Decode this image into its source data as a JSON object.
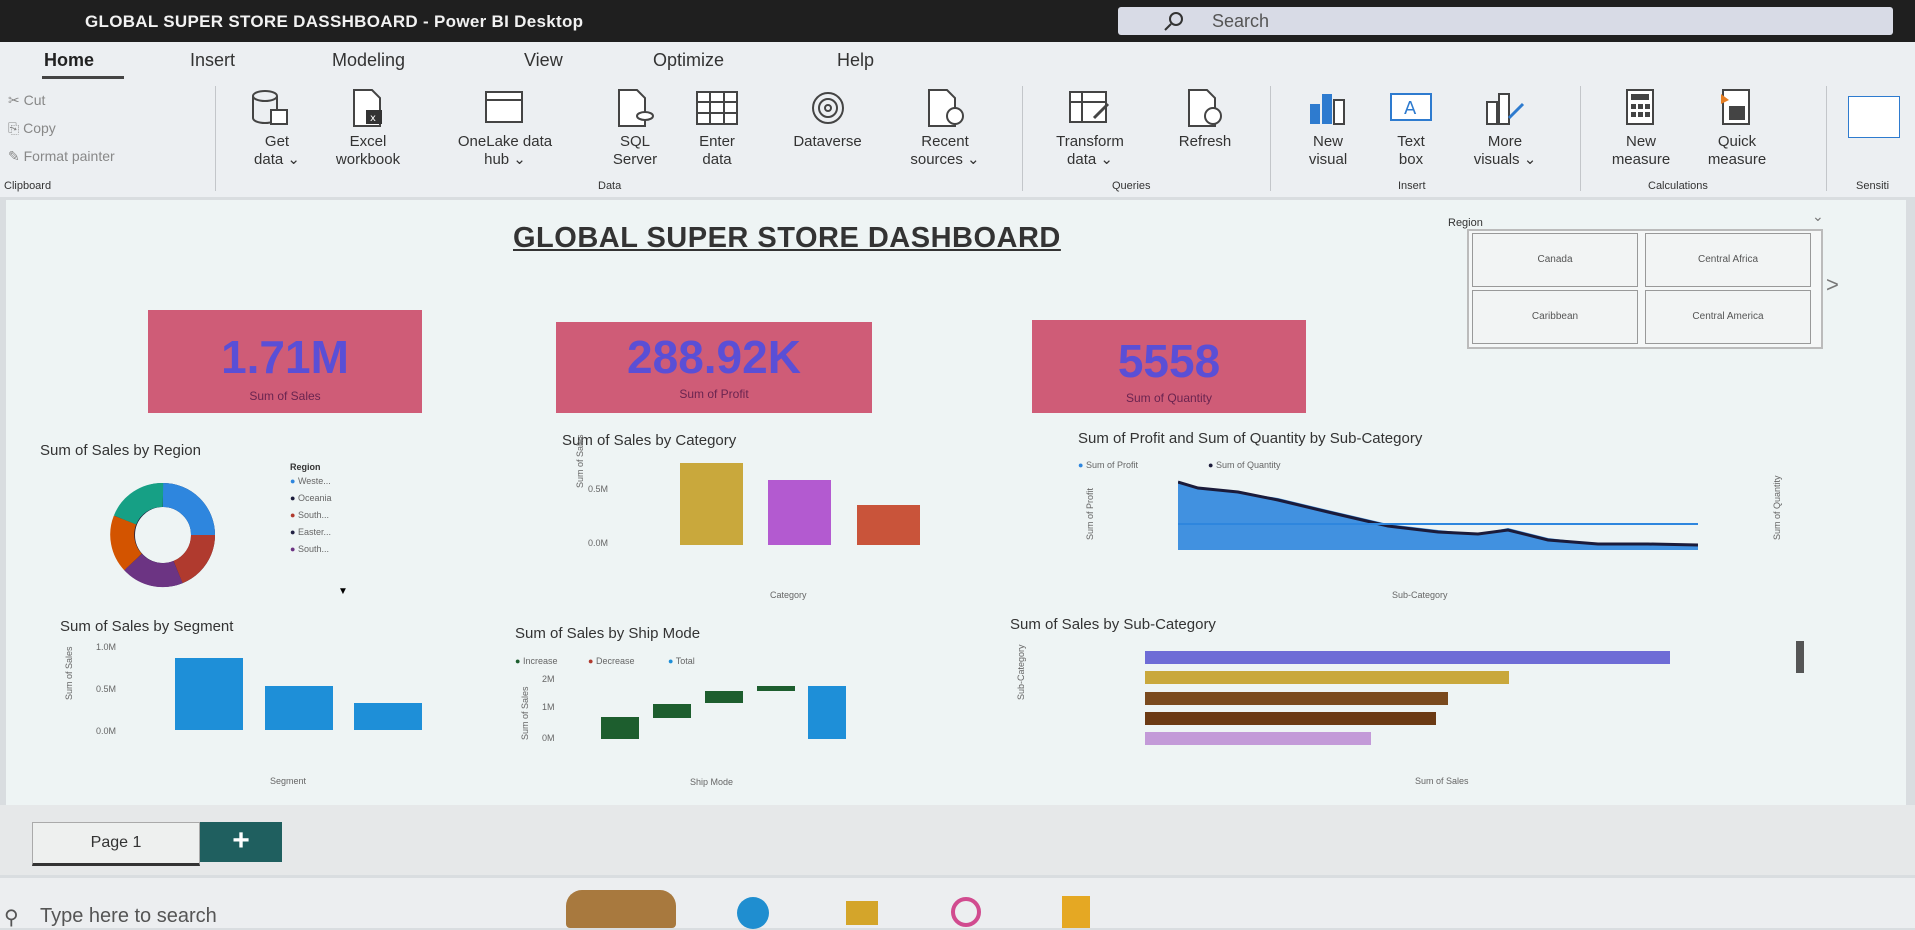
{
  "app": {
    "title": "GLOBAL SUPER STORE DASSHBOARD - Power BI Desktop",
    "search_placeholder": "Search"
  },
  "ribbon": {
    "tabs": [
      "Home",
      "Insert",
      "Modeling",
      "View",
      "Optimize",
      "Help"
    ],
    "clipboard": {
      "cut": "Cut",
      "copy": "Copy",
      "format_painter": "Format painter",
      "label": "Clipboard"
    },
    "data": {
      "get_data": [
        "Get",
        "data ⌄"
      ],
      "excel": [
        "Excel",
        "workbook"
      ],
      "onelake": [
        "OneLake data",
        "hub ⌄"
      ],
      "sql": [
        "SQL",
        "Server"
      ],
      "enter": [
        "Enter",
        "data"
      ],
      "dataverse": [
        "Dataverse",
        ""
      ],
      "recent": [
        "Recent",
        "sources ⌄"
      ],
      "label": "Data"
    },
    "queries": {
      "transform": [
        "Transform",
        "data ⌄"
      ],
      "refresh": [
        "Refresh",
        ""
      ],
      "label": "Queries"
    },
    "insert": {
      "new_visual": [
        "New",
        "visual"
      ],
      "text_box": [
        "Text",
        "box"
      ],
      "more": [
        "More",
        "visuals ⌄"
      ],
      "label": "Insert"
    },
    "calculations": {
      "new_measure": [
        "New",
        "measure"
      ],
      "quick_measure": [
        "Quick",
        "measure"
      ],
      "label": "Calculations"
    },
    "sensitivity": {
      "label": "Sensiti"
    }
  },
  "dashboard": {
    "title": "GLOBAL SUPER STORE DASHBOARD",
    "slicer": {
      "title": "Region",
      "items": [
        "Canada",
        "Central Africa",
        "Caribbean",
        "Central America"
      ]
    },
    "kpis": [
      {
        "value": "1.71M",
        "label": "Sum of Sales"
      },
      {
        "value": "288.92K",
        "label": "Sum of Profit"
      },
      {
        "value": "5558",
        "label": "Sum of Quantity"
      }
    ],
    "charts": {
      "region": {
        "title": "Sum of Sales by Region",
        "legend_title": "Region",
        "legend": [
          "Weste...",
          "Oceania",
          "South...",
          "Easter...",
          "South..."
        ],
        "legend_colors": [
          "#2e86de",
          "#1b1b3a",
          "#b03a2e",
          "#222244",
          "#6c3483"
        ]
      },
      "category": {
        "title": "Sum of Sales by Category",
        "xlabel": "Category",
        "ylabel": "Sum of Sales",
        "ticks": [
          "0.5M",
          "0.0M"
        ]
      },
      "profit_qty": {
        "title": "Sum of Profit and Sum of Quantity by Sub-Category",
        "legend": [
          "Sum of Profit",
          "Sum of Quantity"
        ],
        "xlabel": "Sub-Category",
        "ylabel": "Sum of Profit",
        "ylabel2": "Sum of Quantity"
      },
      "segment": {
        "title": "Sum of Sales by Segment",
        "xlabel": "Segment",
        "ylabel": "Sum of Sales",
        "ticks": [
          "1.0M",
          "0.5M",
          "0.0M"
        ]
      },
      "shipmode": {
        "title": "Sum of Sales by Ship Mode",
        "legend": [
          "Increase",
          "Decrease",
          "Total"
        ],
        "xlabel": "Ship Mode",
        "ylabel": "Sum of Sales",
        "ticks": [
          "2M",
          "1M",
          "0M"
        ]
      },
      "subcategory": {
        "title": "Sum of Sales by Sub-Category",
        "xlabel": "Sum of Sales",
        "ylabel": "Sub-Category"
      }
    }
  },
  "pages": {
    "page1": "Page 1",
    "add": "+"
  },
  "taskbar": {
    "search": "Type here to search"
  }
}
